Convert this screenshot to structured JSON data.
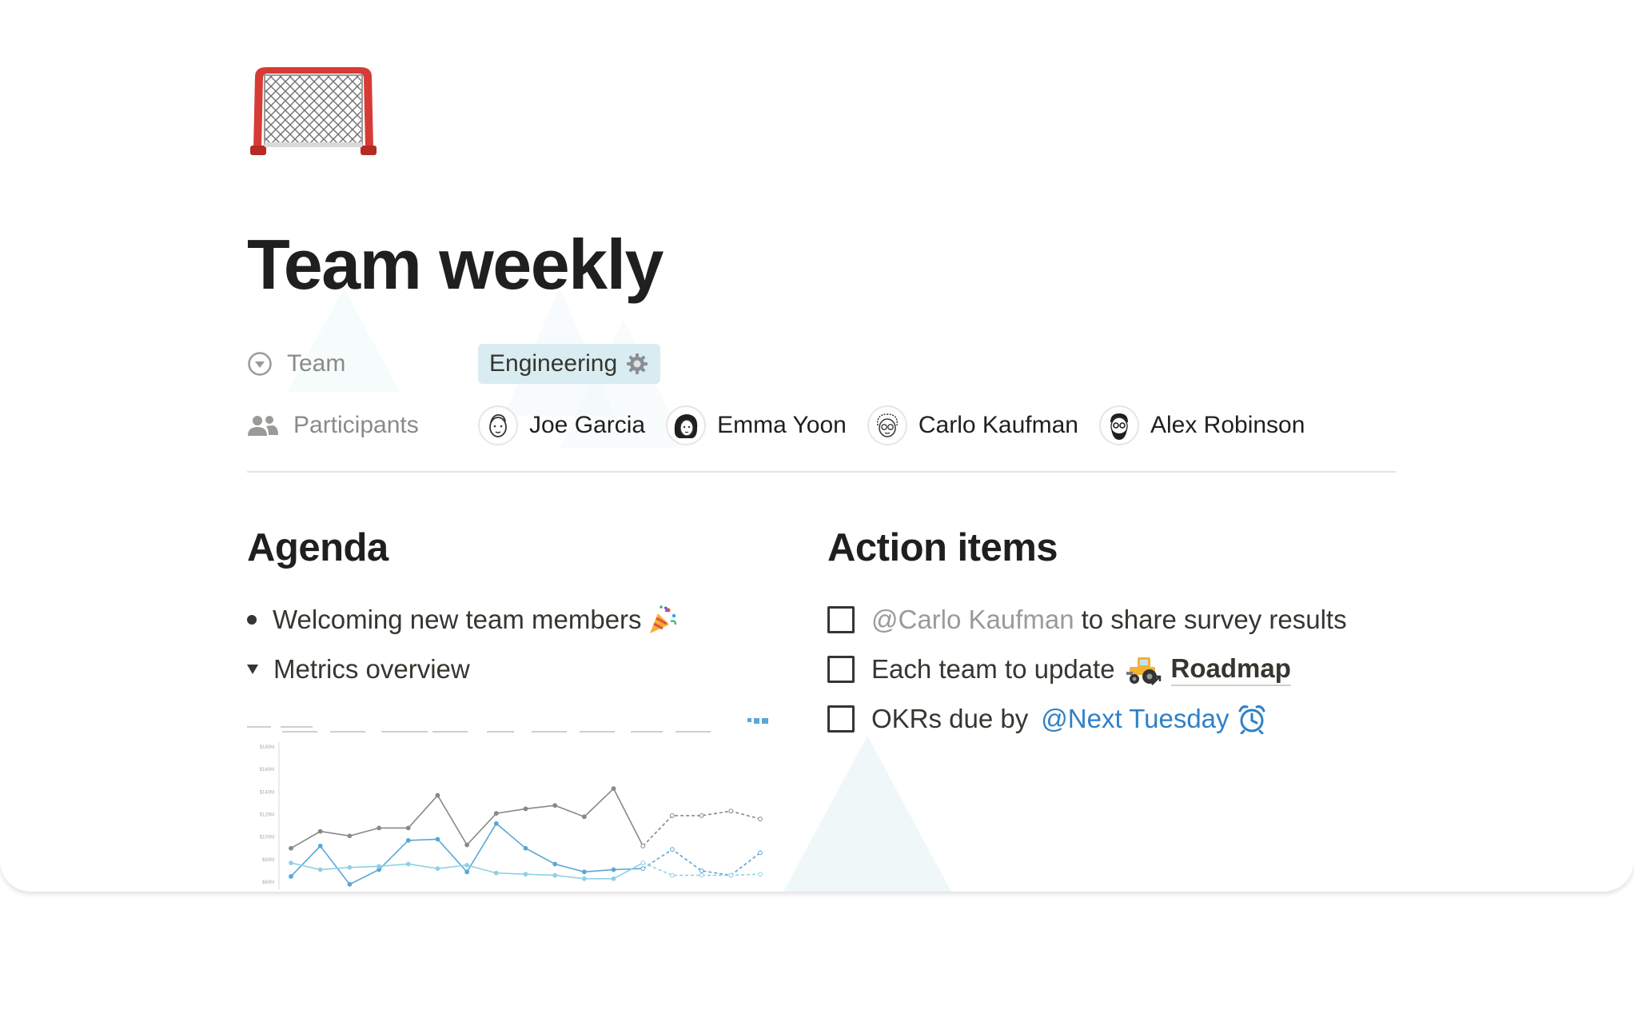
{
  "page": {
    "title": "Team weekly",
    "icon": "hockey-goal-icon"
  },
  "properties": {
    "team": {
      "label": "Team",
      "icon": "chevron-circle-down-icon",
      "value": "Engineering",
      "value_icon": "gear-icon",
      "tag_color": "#d9ecf1"
    },
    "participants": {
      "label": "Participants",
      "icon": "people-icon",
      "people": [
        {
          "name": "Joe Garcia",
          "avatar": "joe-avatar"
        },
        {
          "name": "Emma Yoon",
          "avatar": "emma-avatar"
        },
        {
          "name": "Carlo Kaufman",
          "avatar": "carlo-avatar"
        },
        {
          "name": "Alex Robinson",
          "avatar": "alex-avatar"
        }
      ]
    }
  },
  "agenda": {
    "heading": "Agenda",
    "items": [
      {
        "text": "Welcoming new team members",
        "icon": "party-popper-icon",
        "marker": "bullet"
      },
      {
        "text": "Metrics overview",
        "marker": "toggle-open"
      }
    ]
  },
  "action_items": {
    "heading": "Action items",
    "items": [
      {
        "mention": "@Carlo Kaufman",
        "text": "to share survey results",
        "checked": false
      },
      {
        "text": "Each team to update",
        "page_link": "Roadmap",
        "page_link_icon": "tractor-icon",
        "checked": false
      },
      {
        "text": "OKRs due by",
        "date_mention": "@Next Tuesday",
        "date_icon": "alarm-clock-icon",
        "checked": false
      }
    ]
  },
  "colors": {
    "text": "#37352f",
    "muted": "#9b9a97",
    "mention_blue": "#2f81c7",
    "tag_bg": "#d9ecf1"
  },
  "chart_data": {
    "type": "line",
    "x": [
      1,
      2,
      3,
      4,
      5,
      6,
      7,
      8,
      9,
      10,
      11,
      12,
      13,
      14,
      15,
      16,
      17
    ],
    "y_ticks": [
      "$60M",
      "$80M",
      "$100M",
      "$120M",
      "$140M",
      "$160M",
      "$180M"
    ],
    "series": [
      {
        "color": "#888888",
        "values": [
          90,
          105,
          101,
          108,
          108,
          137,
          93,
          121,
          125,
          128,
          118,
          143,
          92,
          119,
          119,
          123,
          116
        ],
        "dashed_from": 12
      },
      {
        "color": "#5aa7d6",
        "values": [
          65,
          92,
          58,
          71,
          97,
          98,
          69,
          112,
          90,
          76,
          69,
          71,
          72,
          89,
          70,
          66,
          86
        ],
        "dashed_from": 12
      },
      {
        "color": "#8fd1e3",
        "values": [
          77,
          71,
          73,
          74,
          76,
          72,
          75,
          68,
          67,
          66,
          63,
          63,
          77,
          66,
          66,
          66,
          67
        ],
        "dashed_from": 12
      }
    ]
  }
}
